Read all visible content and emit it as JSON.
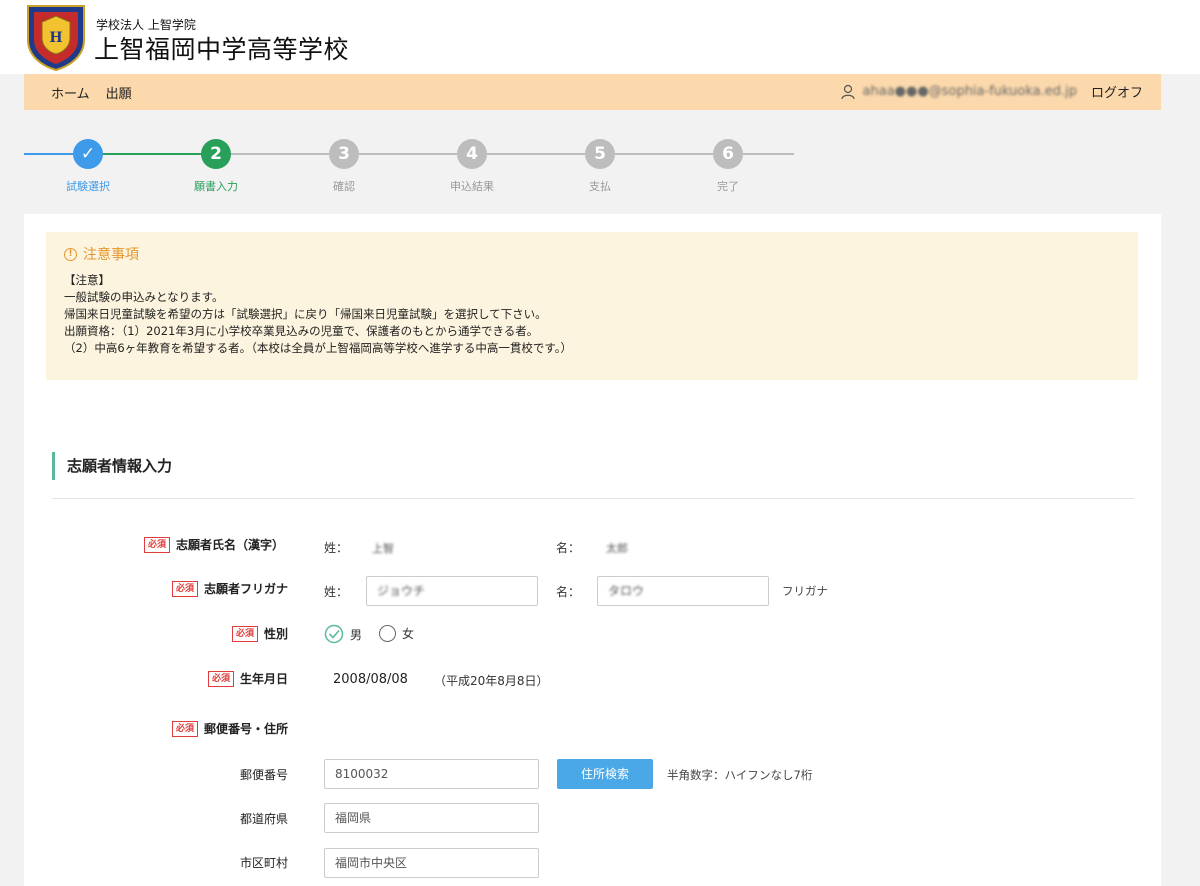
{
  "header": {
    "school_sub": "学校法人 上智学院",
    "school_name": "上智福岡中学高等学校",
    "brand_color": "#fcd9ac"
  },
  "nav": {
    "items": [
      "ホーム",
      "出願"
    ],
    "email": "ahaa●●●@sophia-fukuoka.ed.jp",
    "logout": "ログオフ"
  },
  "steps": [
    {
      "num": "✓",
      "label": "試験選択",
      "state": "done",
      "color": "#3d9be9"
    },
    {
      "num": "2",
      "label": "願書入力",
      "state": "current",
      "color": "#28a05a"
    },
    {
      "num": "3",
      "label": "確認",
      "state": "todo",
      "color": "#bdbdbd"
    },
    {
      "num": "4",
      "label": "申込結果",
      "state": "todo",
      "color": "#bdbdbd"
    },
    {
      "num": "5",
      "label": "支払",
      "state": "todo",
      "color": "#bdbdbd"
    },
    {
      "num": "6",
      "label": "完了",
      "state": "todo",
      "color": "#bdbdbd"
    }
  ],
  "notice": {
    "title": "注意事項",
    "lines": [
      "【注意】",
      "一般試験の申込みとなります。",
      "帰国来日児童試験を希望の方は「試験選択」に戻り「帰国来日児童試験」を選択して下さい。",
      "出願資格：（1）2021年3月に小学校卒業見込みの児童で、保護者のもとから通学できる者。",
      "（2）中高6ヶ年教育を希望する者。（本校は全員が上智福岡高等学校へ進学する中高一貫校です。）"
    ]
  },
  "form": {
    "section_title": "志願者情報入力",
    "required": "必須",
    "name_kanji": {
      "label": "志願者氏名（漢字）",
      "sei_label": "姓：",
      "sei": "上智",
      "mei_label": "名：",
      "mei": "太郎"
    },
    "name_kana": {
      "label": "志願者フリガナ",
      "sei_label": "姓：",
      "sei": "ジョウチ",
      "mei_label": "名：",
      "mei": "タロウ",
      "hint": "フリガナ"
    },
    "gender": {
      "label": "性別",
      "male": "男",
      "female": "女",
      "selected": "男"
    },
    "birthdate": {
      "label": "生年月日",
      "value": "2008/08/08",
      "era": "（平成20年8月8日）"
    },
    "address": {
      "label": "郵便番号・住所",
      "postal_label": "郵便番号",
      "postal": "8100032",
      "search_button": "住所検索",
      "postal_hint": "半角数字：ハイフンなし7桁",
      "pref_label": "都道府県",
      "pref": "福岡県",
      "city_label": "市区町村",
      "city": "福岡市中央区"
    }
  }
}
